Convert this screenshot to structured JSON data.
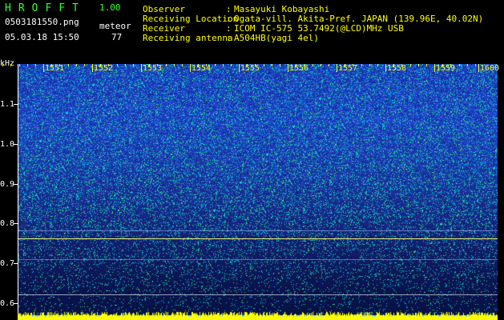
{
  "header": {
    "app_title": "HROFFT",
    "app_version": "1.00",
    "file_name": "0503181550.png",
    "mode_label": "meteor",
    "datetime": "05.03.18 15:50",
    "count": "77"
  },
  "info": [
    {
      "label": "Observer",
      "sep": ":",
      "value": "Masayuki Kobayashi"
    },
    {
      "label": "Receiving Location",
      "sep": ":",
      "value": "Ogata-vill. Akita-Pref. JAPAN (139.96E, 40.02N)"
    },
    {
      "label": "Receiver",
      "sep": ":",
      "value": "ICOM IC-575 53.7492(@LCD)MHz USB"
    },
    {
      "label": "Receiving antenna",
      "sep": ":",
      "value": "A504HB(yagi 4el)"
    }
  ],
  "axes": {
    "y_unit": "kHz",
    "y_ticks": [
      "1.1",
      "1.0",
      "0.9",
      "0.8",
      "0.7",
      "0.6"
    ],
    "time_ticks": [
      "1551",
      "1552",
      "1553",
      "1554",
      "1555",
      "1556",
      "1557",
      "1558",
      "1559",
      "1600"
    ]
  },
  "colors": {
    "text_green": "#33ff33",
    "text_yellow": "#ffff00",
    "text_white": "#ffffff",
    "background": "#000000",
    "spectrum_blue": "#2040c8"
  }
}
